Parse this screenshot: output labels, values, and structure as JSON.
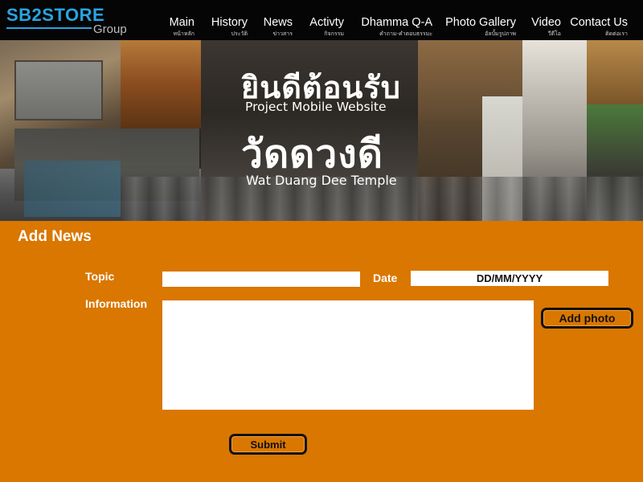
{
  "logo": {
    "main": "SB2STORE",
    "sub": "Group"
  },
  "nav": {
    "items": [
      {
        "label": "Main",
        "sub": "หน้าหลัก"
      },
      {
        "label": "History",
        "sub": "ประวัติ"
      },
      {
        "label": "News",
        "sub": "ข่าวสาร"
      },
      {
        "label": "Activty",
        "sub": "กิจกรรม"
      },
      {
        "label": "Dhamma Q-A",
        "sub": "คำถาม-คำตอบธรรมะ"
      },
      {
        "label": "Photo Gallery",
        "sub": "อัลบั้มรูปภาพ"
      },
      {
        "label": "Video",
        "sub": "วีดีโอ"
      },
      {
        "label": "Contact Us",
        "sub": "ติดต่อเรา"
      }
    ]
  },
  "banner": {
    "welcome_th": "ยินดีต้อนรับ",
    "welcome_en": "Project Mobile Website",
    "temple_th": "วัดดวงดี",
    "temple_en": "Wat Duang Dee Temple"
  },
  "form": {
    "heading": "Add News",
    "topic_label": "Topic",
    "topic_value": "",
    "date_label": "Date",
    "date_placeholder": "DD/MM/YYYY",
    "info_label": "Information",
    "info_value": "",
    "add_photo_label": "Add photo",
    "submit_label": "Submit"
  },
  "colors": {
    "page_background": "#D97700",
    "navbar_background": "#050505",
    "logo_accent": "#29A4E0"
  }
}
